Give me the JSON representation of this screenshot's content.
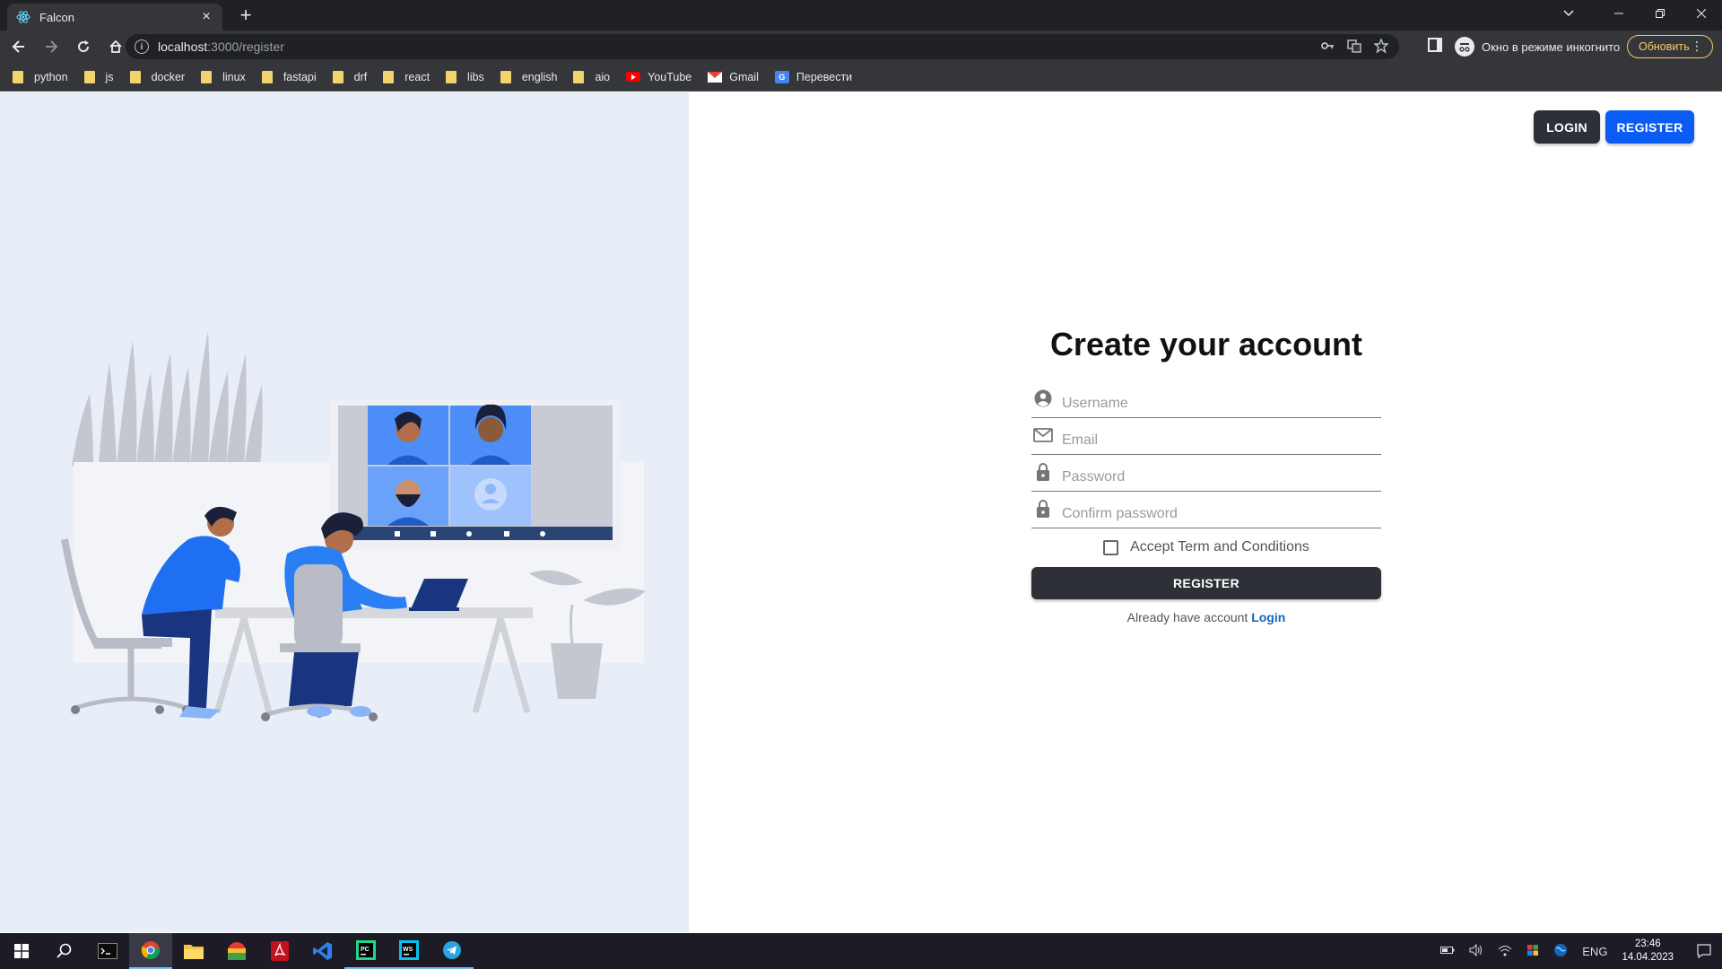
{
  "browser": {
    "tab_title": "Falcon",
    "tab_close": "×",
    "new_tab": "+",
    "url_host": "localhost",
    "url_path": ":3000/register",
    "incognito_label": "Окно в режиме инкогнито",
    "update_label": "Обновить",
    "bookmarks": [
      {
        "label": "python",
        "icon": "folder-icon"
      },
      {
        "label": "js",
        "icon": "folder-icon"
      },
      {
        "label": "docker",
        "icon": "folder-icon"
      },
      {
        "label": "linux",
        "icon": "folder-icon"
      },
      {
        "label": "fastapi",
        "icon": "folder-icon"
      },
      {
        "label": "drf",
        "icon": "folder-icon"
      },
      {
        "label": "react",
        "icon": "folder-icon"
      },
      {
        "label": "libs",
        "icon": "folder-icon"
      },
      {
        "label": "english",
        "icon": "folder-icon"
      },
      {
        "label": "aio",
        "icon": "folder-icon"
      },
      {
        "label": "YouTube",
        "icon": "youtube-icon"
      },
      {
        "label": "Gmail",
        "icon": "gmail-icon"
      },
      {
        "label": "Перевести",
        "icon": "translate-icon"
      }
    ]
  },
  "page": {
    "nav": {
      "login_label": "LOGIN",
      "register_label": "REGISTER"
    },
    "form": {
      "title": "Create your account",
      "username_placeholder": "Username",
      "email_placeholder": "Email",
      "password_placeholder": "Password",
      "confirm_placeholder": "Confirm password",
      "terms_label": "Accept Term and Conditions",
      "submit_label": "REGISTER",
      "already_text": "Already have account",
      "login_link": "Login"
    },
    "colors": {
      "left_bg": "#e8eef8",
      "dark_button": "#2d3036",
      "primary_button": "#0a5cf5",
      "link": "#1565c0"
    }
  },
  "taskbar": {
    "lang": "ENG",
    "time": "23:46",
    "date": "14.04.2023"
  }
}
